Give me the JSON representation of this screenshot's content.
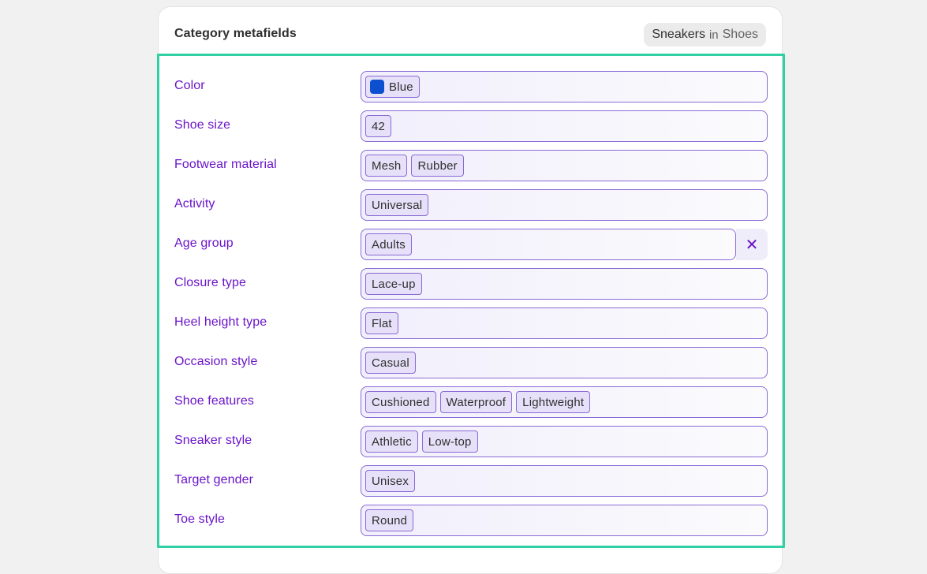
{
  "header": {
    "title": "Category metafields",
    "category_name": "Sneakers",
    "category_sep": "in",
    "category_parent": "Shoes"
  },
  "fields": [
    {
      "label": "Color",
      "values": [
        "Blue"
      ],
      "swatch_color": "#0c4fcf"
    },
    {
      "label": "Shoe size",
      "values": [
        "42"
      ]
    },
    {
      "label": "Footwear material",
      "values": [
        "Mesh",
        "Rubber"
      ]
    },
    {
      "label": "Activity",
      "values": [
        "Universal"
      ]
    },
    {
      "label": "Age group",
      "values": [
        "Adults"
      ],
      "clear_icon": "close-icon"
    },
    {
      "label": "Closure type",
      "values": [
        "Lace-up"
      ]
    },
    {
      "label": "Heel height type",
      "values": [
        "Flat"
      ]
    },
    {
      "label": "Occasion style",
      "values": [
        "Casual"
      ]
    },
    {
      "label": "Shoe features",
      "values": [
        "Cushioned",
        "Waterproof",
        "Lightweight"
      ]
    },
    {
      "label": "Sneaker style",
      "values": [
        "Athletic",
        "Low-top"
      ]
    },
    {
      "label": "Target gender",
      "values": [
        "Unisex"
      ]
    },
    {
      "label": "Toe style",
      "values": [
        "Round"
      ]
    }
  ],
  "colors": {
    "label": "#6a14c9",
    "highlight_border": "#2fd0a4",
    "chip_border": "#8a6bd6",
    "swatch_blue": "#0c4fcf"
  }
}
